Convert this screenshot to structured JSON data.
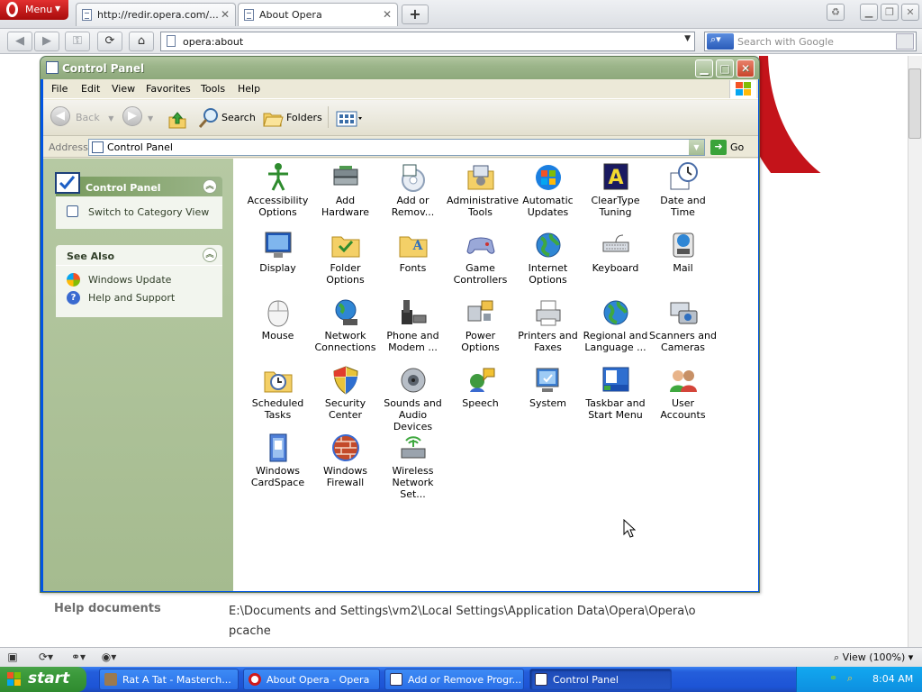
{
  "opera": {
    "menu_label": "Menu",
    "tabs": [
      {
        "title": "http://redir.opera.com/..."
      },
      {
        "title": "About Opera"
      }
    ],
    "address": "opera:about",
    "search_placeholder": "Search with Google",
    "help_label": "Help documents",
    "help_path": "E:\\Documents and Settings\\vm2\\Local Settings\\Application Data\\Opera\\Opera\\opcache",
    "zoom": "View (100%)"
  },
  "window": {
    "title": "Control Panel",
    "menu": [
      "File",
      "Edit",
      "View",
      "Favorites",
      "Tools",
      "Help"
    ],
    "toolbar": {
      "back": "Back",
      "search": "Search",
      "folders": "Folders"
    },
    "address_label": "Address",
    "address_value": "Control Panel",
    "go": "Go",
    "control_panel_section": {
      "title": "Control Panel",
      "switch_link": "Switch to Category View"
    },
    "see_also": {
      "title": "See Also",
      "links": [
        "Windows Update",
        "Help and Support"
      ]
    },
    "items": [
      {
        "label": "Accessibility Options",
        "icon": "accessibility-icon"
      },
      {
        "label": "Add Hardware",
        "icon": "hardware-icon"
      },
      {
        "label": "Add or Remov...",
        "icon": "add-remove-icon"
      },
      {
        "label": "Administrative Tools",
        "icon": "admin-tools-icon"
      },
      {
        "label": "Automatic Updates",
        "icon": "windows-update-icon"
      },
      {
        "label": "ClearType Tuning",
        "icon": "cleartype-icon"
      },
      {
        "label": "Date and Time",
        "icon": "clock-icon"
      },
      {
        "label": "Display",
        "icon": "display-icon"
      },
      {
        "label": "Folder Options",
        "icon": "folder-icon"
      },
      {
        "label": "Fonts",
        "icon": "fonts-folder-icon"
      },
      {
        "label": "Game Controllers",
        "icon": "gamepad-icon"
      },
      {
        "label": "Internet Options",
        "icon": "globe-icon"
      },
      {
        "label": "Keyboard",
        "icon": "keyboard-icon"
      },
      {
        "label": "Mail",
        "icon": "mail-icon"
      },
      {
        "label": "Mouse",
        "icon": "mouse-icon"
      },
      {
        "label": "Network Connections",
        "icon": "network-icon"
      },
      {
        "label": "Phone and Modem ...",
        "icon": "phone-icon"
      },
      {
        "label": "Power Options",
        "icon": "power-icon"
      },
      {
        "label": "Printers and Faxes",
        "icon": "printer-icon"
      },
      {
        "label": "Regional and Language ...",
        "icon": "globe-icon"
      },
      {
        "label": "Scanners and Cameras",
        "icon": "camera-icon"
      },
      {
        "label": "Scheduled Tasks",
        "icon": "scheduled-tasks-icon"
      },
      {
        "label": "Security Center",
        "icon": "shield-icon"
      },
      {
        "label": "Sounds and Audio Devices",
        "icon": "speaker-icon"
      },
      {
        "label": "Speech",
        "icon": "speech-icon"
      },
      {
        "label": "System",
        "icon": "system-icon"
      },
      {
        "label": "Taskbar and Start Menu",
        "icon": "taskbar-icon"
      },
      {
        "label": "User Accounts",
        "icon": "users-icon"
      },
      {
        "label": "Windows CardSpace",
        "icon": "cardspace-icon"
      },
      {
        "label": "Windows Firewall",
        "icon": "firewall-icon"
      },
      {
        "label": "Wireless Network Set...",
        "icon": "wireless-icon"
      }
    ]
  },
  "taskbar": {
    "start": "start",
    "tasks": [
      "Rat A Tat - Masterch...",
      "About Opera - Opera",
      "Add or Remove Progr...",
      "Control Panel"
    ],
    "clock": "8:04 AM"
  },
  "colors": {
    "xp_green_title": "#9cb58a",
    "taskbar_blue": "#245edb",
    "opera_red": "#c4131a"
  }
}
